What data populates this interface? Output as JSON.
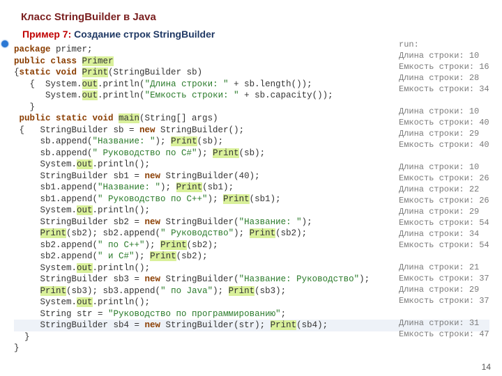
{
  "title": "Класс StringBuilder в Java",
  "subtitle_red": "Пример 7:",
  "subtitle_blue": "Создание строк StringBuilder",
  "page_number": "14",
  "code": {
    "l1_kw": "package",
    "l1_rest": " primer;",
    "l2_kw1": "public class ",
    "l2_hl": "Primer",
    "l3a": "{",
    "l3_kw": "static void ",
    "l3_hl": "Print",
    "l3_rest": "(StringBuilder sb)",
    "l4a": "   {  System.",
    "l4_out": "out",
    "l4_mid": ".println(",
    "l4_str": "\"Длина строки: \"",
    "l4_end": " + sb.length());",
    "l5a": "      System.",
    "l5_out": "out",
    "l5_mid": ".println(",
    "l5_str": "\"Емкость строки: \"",
    "l5_end": " + sb.capacity());",
    "l6": "   }",
    "l7_kw": " public static void ",
    "l7_hl": "main",
    "l7_rest": "(String[] args)",
    "l8a": " {   StringBuilder sb = ",
    "l8_kw": "new",
    "l8_rest": " StringBuilder();",
    "l9a": "     sb.append(",
    "l9_str": "\"Название: \"",
    "l9_mid": "); ",
    "l9_hl": "Print",
    "l9_end": "(sb);",
    "l10a": "     sb.append(",
    "l10_str": "\" Руководство по C#\"",
    "l10_mid": "); ",
    "l10_hl": "Print",
    "l10_end": "(sb);",
    "l11a": "     System.",
    "l11_out": "out",
    "l11_end": ".println();",
    "l12a": "     StringBuilder sb1 = ",
    "l12_kw": "new",
    "l12_rest": " StringBuilder(40);",
    "l13a": "     sb1.append(",
    "l13_str": "\"Название: \"",
    "l13_mid": "); ",
    "l13_hl": "Print",
    "l13_end": "(sb1);",
    "l14a": "     sb1.append(",
    "l14_str": "\" Руководство по C++\"",
    "l14_mid": "); ",
    "l14_hl": "Print",
    "l14_end": "(sb1);",
    "l15a": "     System.",
    "l15_out": "out",
    "l15_end": ".println();",
    "l16a": "     StringBuilder sb2 = ",
    "l16_kw": "new",
    "l16_mid": " StringBuilder(",
    "l16_str": "\"Название: \"",
    "l16_end": ");",
    "l17a": "     ",
    "l17_hl1": "Print",
    "l17_mid1": "(sb2); sb2.append(",
    "l17_str": "\" Руководство\"",
    "l17_mid2": "); ",
    "l17_hl2": "Print",
    "l17_end": "(sb2);",
    "l18a": "     sb2.append(",
    "l18_str": "\" по C++\"",
    "l18_mid": "); ",
    "l18_hl": "Print",
    "l18_end": "(sb2);",
    "l19a": "     sb2.append(",
    "l19_str": "\" и C#\"",
    "l19_mid": "); ",
    "l19_hl": "Print",
    "l19_end": "(sb2);",
    "l20a": "     System.",
    "l20_out": "out",
    "l20_end": ".println();",
    "l21a": "     StringBuilder sb3 = ",
    "l21_kw": "new",
    "l21_mid": " StringBuilder(",
    "l21_str": "\"Название: Руководство\"",
    "l21_end": ");",
    "l22a": "     ",
    "l22_hl1": "Print",
    "l22_mid1": "(sb3); sb3.append(",
    "l22_str": "\" по Java\"",
    "l22_mid2": "); ",
    "l22_hl2": "Print",
    "l22_end": "(sb3);",
    "l23a": "     System.",
    "l23_out": "out",
    "l23_end": ".println();",
    "l24a": "     String str = ",
    "l24_str": "\"Руководство по программированию\"",
    "l24_end": ";",
    "l25a": "     StringBuilder sb4 = ",
    "l25_kw": "new",
    "l25_mid": " StringBuilder(str); ",
    "l25_hl": "Print",
    "l25_end": "(sb4);",
    "l26": "  }",
    "l27": "}"
  },
  "output_lines": [
    "run:",
    "Длина строки: 10",
    "Емкость строки: 16",
    "Длина строки: 28",
    "Емкость строки: 34",
    "",
    "Длина строки: 10",
    "Емкость строки: 40",
    "Длина строки: 29",
    "Емкость строки: 40",
    "",
    "Длина строки: 10",
    "Емкость строки: 26",
    "Длина строки: 22",
    "Емкость строки: 26",
    "Длина строки: 29",
    "Емкость строки: 54",
    "Длина строки: 34",
    "Емкость строки: 54",
    "",
    "Длина строки: 21",
    "Емкость строки: 37",
    "Длина строки: 29",
    "Емкость строки: 37",
    "",
    "Длина строки: 31",
    "Емкость строки: 47"
  ]
}
